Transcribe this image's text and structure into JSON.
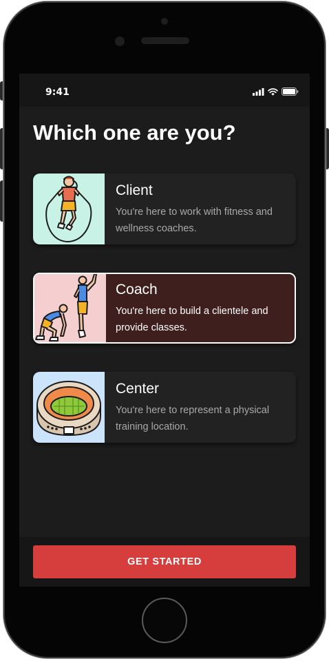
{
  "status": {
    "time": "9:41"
  },
  "title": "Which one are you?",
  "options": [
    {
      "title": "Client",
      "description": "You're here to work with fitness and wellness coaches.",
      "icon": "jump-rope-person-icon",
      "bg": "#c9f2e6"
    },
    {
      "title": "Coach",
      "description": "You're here to build a clientele and provide classes.",
      "icon": "coach-trainer-icon",
      "bg": "#f5cfcf",
      "selected": true
    },
    {
      "title": "Center",
      "description": "You're here to represent a physical training location.",
      "icon": "stadium-icon",
      "bg": "#cbe4fb"
    }
  ],
  "cta_label": "GET STARTED",
  "colors": {
    "accent": "#d63e3e",
    "selected_card": "#3f1f1e",
    "card": "#222222",
    "background": "#1c1c1c"
  }
}
